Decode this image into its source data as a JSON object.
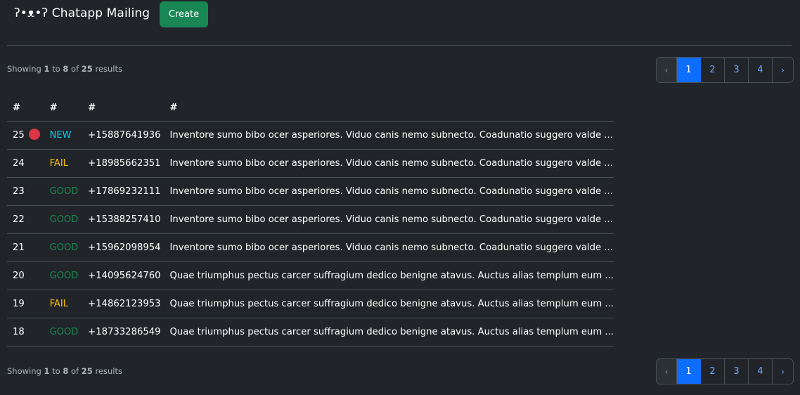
{
  "app": {
    "title": "ʔ•ᴥ•ʔ Chatapp Mailing",
    "create_label": "Create"
  },
  "summary": {
    "showing": "Showing",
    "from": "1",
    "to_word": "to",
    "to": "8",
    "of_word": "of",
    "total": "25",
    "results": "results"
  },
  "pagination": {
    "prev": "‹",
    "next": "›",
    "pages": [
      "1",
      "2",
      "3",
      "4"
    ],
    "current": "1"
  },
  "table": {
    "headers": [
      "#",
      "#",
      "#",
      "#"
    ],
    "status_colors": {
      "NEW": "#0dcaf0",
      "FAIL": "#ffc107",
      "GOOD": "#198754"
    },
    "rows": [
      {
        "id": "25",
        "unread": true,
        "status": "NEW",
        "phone": "+15887641936",
        "message": "Inventore sumo bibo ocer asperiores. Viduo canis nemo subnecto. Coadunatio suggero valde ..."
      },
      {
        "id": "24",
        "unread": false,
        "status": "FAIL",
        "phone": "+18985662351",
        "message": "Inventore sumo bibo ocer asperiores. Viduo canis nemo subnecto. Coadunatio suggero valde ..."
      },
      {
        "id": "23",
        "unread": false,
        "status": "GOOD",
        "phone": "+17869232111",
        "message": "Inventore sumo bibo ocer asperiores. Viduo canis nemo subnecto. Coadunatio suggero valde ..."
      },
      {
        "id": "22",
        "unread": false,
        "status": "GOOD",
        "phone": "+15388257410",
        "message": "Inventore sumo bibo ocer asperiores. Viduo canis nemo subnecto. Coadunatio suggero valde ..."
      },
      {
        "id": "21",
        "unread": false,
        "status": "GOOD",
        "phone": "+15962098954",
        "message": "Inventore sumo bibo ocer asperiores. Viduo canis nemo subnecto. Coadunatio suggero valde ..."
      },
      {
        "id": "20",
        "unread": false,
        "status": "GOOD",
        "phone": "+14095624760",
        "message": "Quae triumphus pectus carcer suffragium dedico benigne atavus. Auctus alias templum eum ..."
      },
      {
        "id": "19",
        "unread": false,
        "status": "FAIL",
        "phone": "+14862123953",
        "message": "Quae triumphus pectus carcer suffragium dedico benigne atavus. Auctus alias templum eum ..."
      },
      {
        "id": "18",
        "unread": false,
        "status": "GOOD",
        "phone": "+18733286549",
        "message": "Quae triumphus pectus carcer suffragium dedico benigne atavus. Auctus alias templum eum ..."
      }
    ]
  }
}
